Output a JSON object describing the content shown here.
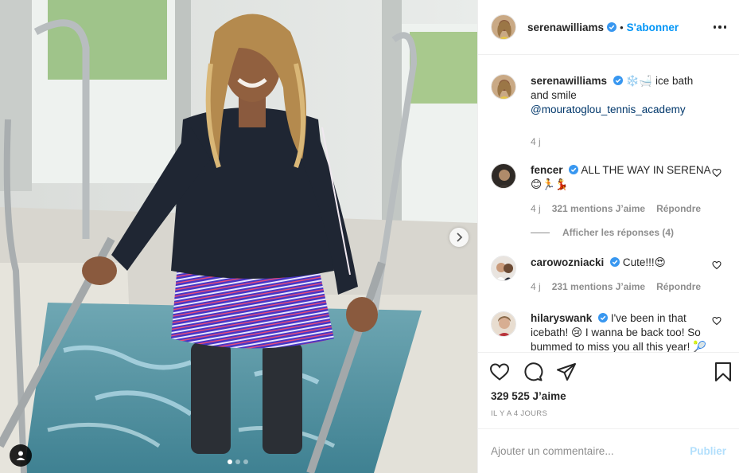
{
  "post": {
    "username": "serenawilliams",
    "follow_label": "S'abonner",
    "separator": "•",
    "caption_text": "❄️🛁 ice bath and smile ",
    "caption_mention": "@mouratoglou_tennis_academy",
    "caption_time": "4 j",
    "likes_label": "329 525 J’aime",
    "date_label": "IL Y A 4 JOURS",
    "add_comment_placeholder": "Ajouter un commentaire...",
    "publish_label": "Publier",
    "carousel": {
      "slides": 3,
      "active_index": 0
    }
  },
  "comments": [
    {
      "username": "fencer",
      "text": "ALL THE WAY IN SERENA 😊🏃💃",
      "time": "4 j",
      "likes": "321 mentions J’aime",
      "reply": "Répondre",
      "view_replies": "Afficher les réponses (4)"
    },
    {
      "username": "carowozniacki",
      "text": "Cute!!!😍",
      "time": "4 j",
      "likes": "231 mentions J’aime",
      "reply": "Répondre"
    },
    {
      "username": "hilaryswank",
      "text": "I've been in that icebath! 😢 I wanna be back too! So bummed to miss you all this year! 🎾💃"
    }
  ],
  "colors": {
    "accent": "#0095f6",
    "verified": "#3897f0",
    "secondary_text": "#8e8e8e",
    "mention": "#00376b"
  },
  "icons": [
    "verified-badge-icon",
    "heart-icon",
    "comment-icon",
    "share-icon",
    "bookmark-icon",
    "more-options-icon",
    "chevron-right-icon",
    "user-tag-icon"
  ]
}
